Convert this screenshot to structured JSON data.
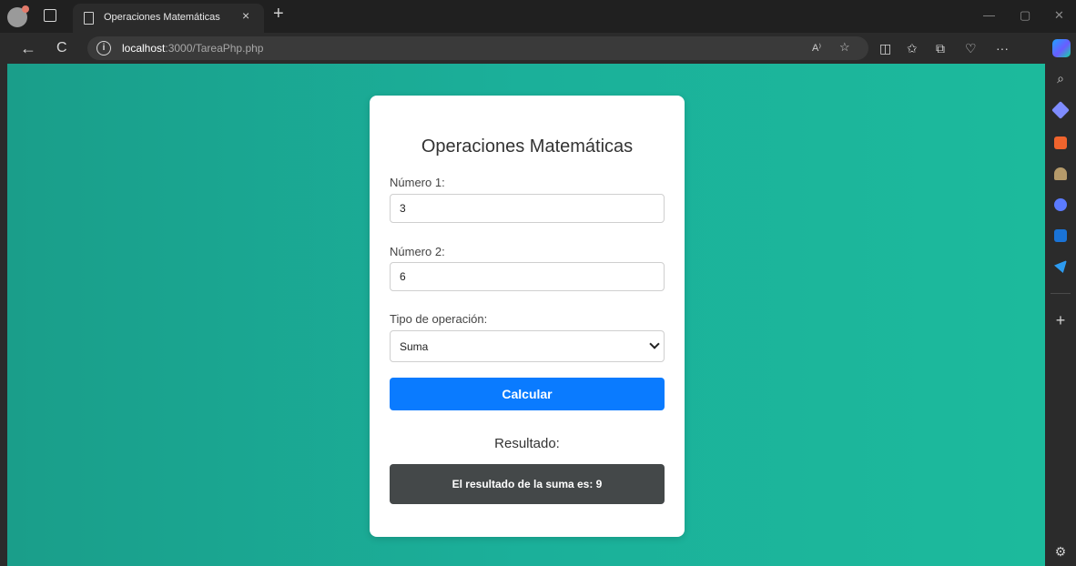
{
  "browser": {
    "tab_title": "Operaciones Matemáticas",
    "tab_close": "×",
    "new_tab": "+",
    "url_host": "localhost",
    "url_path": ":3000/TareaPhp.php",
    "nav_back": "←",
    "nav_refresh": "C",
    "read_aloud": "A⁾",
    "toolbar_more": "···",
    "window_minimize": "—",
    "window_restore": "▢",
    "window_close": "✕"
  },
  "form": {
    "title": "Operaciones Matemáticas",
    "numero1_label": "Número 1:",
    "numero1_value": "3",
    "numero2_label": "Número 2:",
    "numero2_value": "6",
    "operacion_label": "Tipo de operación:",
    "operacion_selected": "Suma",
    "calcular_label": "Calcular",
    "resultado_heading": "Resultado:",
    "resultado_text": "El resultado de la suma es: 9"
  },
  "sidebar": {
    "add": "+",
    "search": "⌕",
    "settings": "⚙"
  },
  "colors": {
    "content_bg": "#1bb09a",
    "button": "#0a7bff",
    "result_bg": "#444849"
  }
}
